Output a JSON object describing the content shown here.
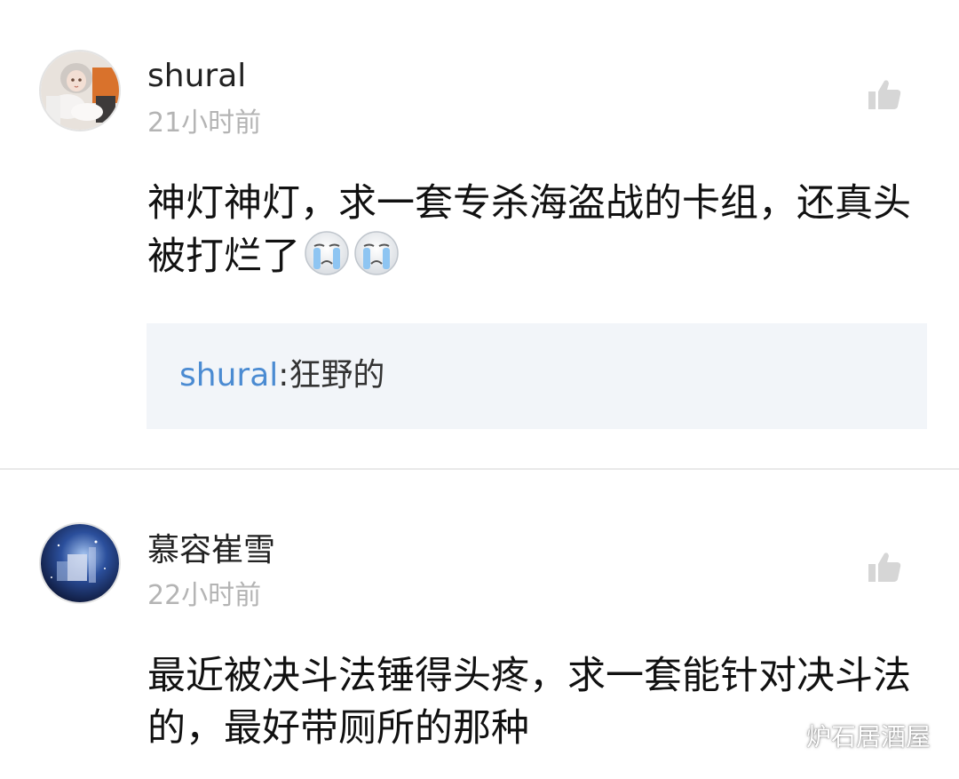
{
  "comments": [
    {
      "username": "shural",
      "time": "21小时前",
      "text": "神灯神灯，求一套专杀海盗战的卡组，还真头被打烂了",
      "emoji": "crying-face-icon",
      "emoji_count": 2,
      "reply": {
        "author": "shural",
        "separator": ":",
        "text": "狂野的"
      }
    },
    {
      "username": "慕容崔雪",
      "time": "22小时前",
      "text": "最近被决斗法锤得头疼，求一套能针对决斗法的，最好带厕所的那种"
    }
  ],
  "watermark": {
    "icon": "wechat-icon",
    "label": "炉石居酒屋"
  },
  "colors": {
    "reply_author": "#4b8bd2",
    "reply_background": "#f2f5f9",
    "timestamp": "#b4b4b4",
    "like_icon": "#d6d6d6"
  }
}
